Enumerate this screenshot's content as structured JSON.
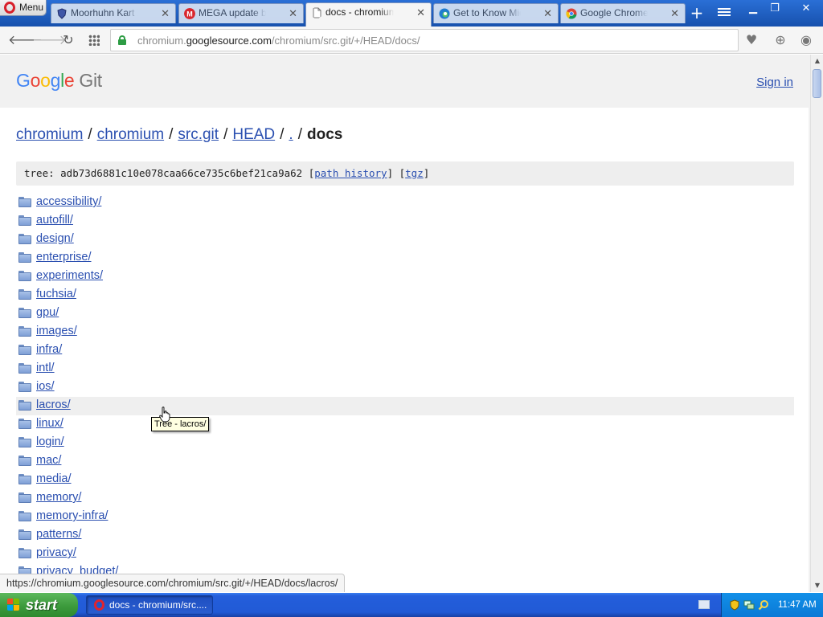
{
  "browser": {
    "menu_label": "Menu",
    "tabs": [
      {
        "title": "Moorhuhn Kart XS | G",
        "active": false,
        "favicon": "shield-favicon-icon"
      },
      {
        "title": "MEGA update browse",
        "active": false,
        "favicon": "mega-favicon-icon"
      },
      {
        "title": "docs - chromium/src.g",
        "active": true,
        "favicon": "page-favicon-icon"
      },
      {
        "title": "Get to Know Microsof",
        "active": false,
        "favicon": "edge-favicon-icon"
      },
      {
        "title": "Google Chrome Web",
        "active": false,
        "favicon": "chrome-favicon-icon"
      }
    ],
    "close_glyph": "✕",
    "url_host_prefix": "chromium.",
    "url_domain": "googlesource.com",
    "url_path": "/chromium/src.git/+/HEAD/docs/",
    "status_url": "https://chromium.googlesource.com/chromium/src.git/+/HEAD/docs/lacros/"
  },
  "site": {
    "logo_google": "Google",
    "logo_git": "Git",
    "signin_label": "Sign in"
  },
  "breadcrumbs": {
    "items": [
      "chromium",
      "chromium",
      "src.git",
      "HEAD",
      "."
    ],
    "separator": "/",
    "current": "docs"
  },
  "tree": {
    "prefix": "tree: adb73d6881c10e078caa66ce735c6bef21ca9a62",
    "path_history_label": "path history",
    "tgz_label": "tgz"
  },
  "files": [
    "accessibility/",
    "autofill/",
    "design/",
    "enterprise/",
    "experiments/",
    "fuchsia/",
    "gpu/",
    "images/",
    "infra/",
    "intl/",
    "ios/",
    "lacros/",
    "linux/",
    "login/",
    "mac/",
    "media/",
    "memory/",
    "memory-infra/",
    "patterns/",
    "privacy/",
    "privacy_budget/"
  ],
  "hovered_file": "lacros/",
  "tooltip": "Tree - lacros/",
  "taskbar": {
    "start_label": "start",
    "task_label": "docs - chromium/src....",
    "clock": "11:47 AM"
  },
  "colors": {
    "link": "#2a4fb0",
    "google_blue": "#4285f4",
    "google_red": "#ea4335",
    "google_yellow": "#fbbc05",
    "google_green": "#34a853",
    "lock_green": "#2d9c44"
  }
}
